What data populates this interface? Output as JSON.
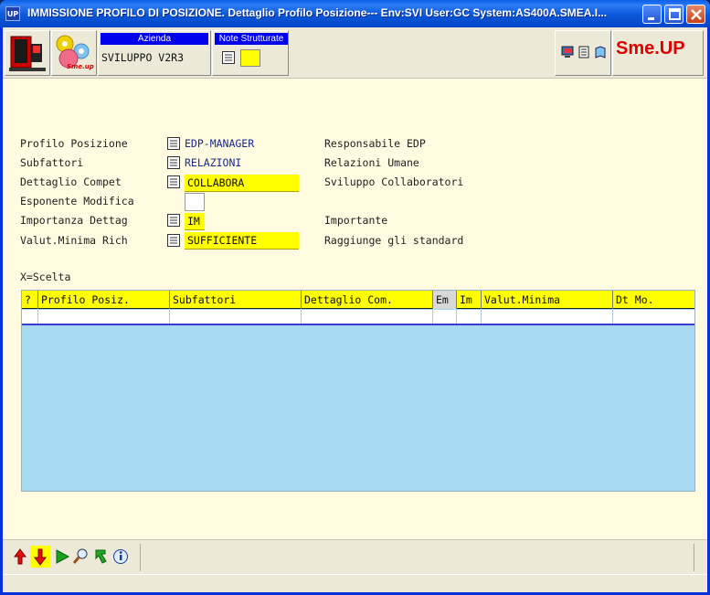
{
  "window": {
    "title": "IMMISSIONE PROFILO DI POSIZIONE.  Dettaglio Profilo Posizione--- Env:SVI User:GC System:AS400A.SMEA.I...",
    "app_icon_text": "UP"
  },
  "toolbar": {
    "azienda_label": "Azienda",
    "azienda_value": "SVILUPPO V2R3",
    "note_label": "Note Strutturate",
    "smeup_logo_text": "Sme.UP",
    "logo_caption": "Sme.up"
  },
  "form": {
    "profilo_posizione": {
      "label": "Profilo Posizione",
      "value": "EDP-MANAGER",
      "description": "Responsabile EDP"
    },
    "subfattori": {
      "label": "Subfattori",
      "value": "RELAZIONI",
      "description": "Relazioni Umane"
    },
    "dettaglio_compet": {
      "label": "Dettaglio Compet",
      "value": "COLLABORA",
      "description": "Sviluppo Collaboratori"
    },
    "esponente_modifica": {
      "label": "Esponente Modifica",
      "value": ""
    },
    "importanza_dettag": {
      "label": "Importanza Dettag",
      "value": "IM",
      "description": "Importante"
    },
    "valut_minima_rich": {
      "label": "Valut.Minima Rich",
      "value": "SUFFICIENTE",
      "description": "Raggiunge gli standard"
    }
  },
  "list": {
    "selection_hint": "X=Scelta",
    "columns": [
      "?",
      "Profilo Posiz.",
      "Subfattori",
      "Dettaglio Com.",
      "Em",
      "Im",
      "Valut.Minima",
      "Dt Mo."
    ]
  },
  "colors": {
    "title_bar": "#0a58d8",
    "field_highlight": "#ffff00",
    "grid_background": "#a6d9f0",
    "panel_background": "#fffbe0"
  }
}
